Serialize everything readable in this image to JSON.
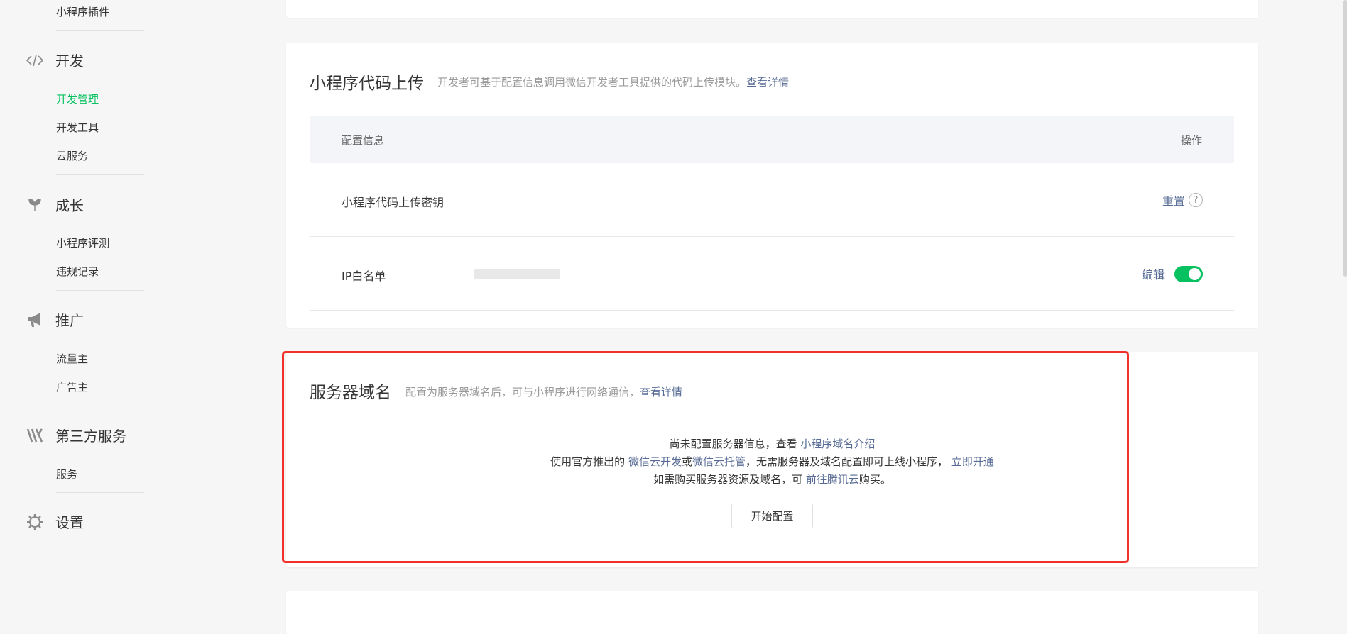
{
  "sidebar": {
    "top_item": "小程序插件",
    "sections": [
      {
        "title": "开发",
        "icon": "code-icon",
        "items": [
          "开发管理",
          "开发工具",
          "云服务"
        ],
        "active": "开发管理"
      },
      {
        "title": "成长",
        "icon": "sprout-icon",
        "items": [
          "小程序评测",
          "违规记录"
        ]
      },
      {
        "title": "推广",
        "icon": "megaphone-icon",
        "items": [
          "流量主",
          "广告主"
        ]
      },
      {
        "title": "第三方服务",
        "icon": "third-party-icon",
        "items": [
          "服务"
        ]
      },
      {
        "title": "设置",
        "icon": "gear-icon",
        "items": []
      }
    ]
  },
  "upload_card": {
    "title": "小程序代码上传",
    "desc": "开发者可基于配置信息调用微信开发者工具提供的代码上传模块。",
    "desc_link": "查看详情",
    "table_header": {
      "col1": "配置信息",
      "col2": "操作"
    },
    "rows": [
      {
        "label": "小程序代码上传密钥",
        "action": "重置",
        "help": "?"
      },
      {
        "label": "IP白名单",
        "action": "编辑",
        "toggle_on": true
      }
    ]
  },
  "server_card": {
    "title": "服务器域名",
    "desc": "配置为服务器域名后，可与小程序进行网络通信，",
    "desc_link": "查看详情",
    "line1_text": "尚未配置服务器信息，查看",
    "line1_link": "小程序域名介绍",
    "line2_pre": "使用官方推出的",
    "line2_link1": "微信云开发",
    "line2_or": "或",
    "line2_link2": "微信云托管",
    "line2_mid": "，无需服务器及域名配置即可上线小程序，",
    "line2_link3": "立即开通",
    "line3_pre": "如需购买服务器资源及域名，可",
    "line3_link": "前往腾讯云",
    "line3_post": "购买。",
    "button": "开始配置"
  },
  "colors": {
    "accent_green": "#07c160",
    "link_blue": "#576b95",
    "highlight_red": "#f2302a"
  }
}
